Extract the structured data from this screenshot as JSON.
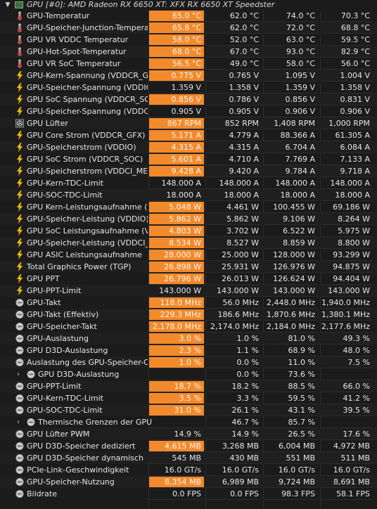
{
  "header": {
    "title": "GPU [#0]: AMD Radeon RX 6650 XT: XFX RX 6650 XT Speedster"
  },
  "rows": [
    {
      "icon": "thermometer-icon",
      "label": "GPU-Temperatur",
      "current": "65.0 °C",
      "min": "62.0 °C",
      "max": "74.0 °C",
      "avg": "70.3 °C",
      "hi": true
    },
    {
      "icon": "thermometer-icon",
      "label": "GPU-Speicher-Junction-Temperatur",
      "current": "65.8 °C",
      "min": "62.0 °C",
      "max": "72.0 °C",
      "avg": "68.8 °C",
      "hi": true
    },
    {
      "icon": "thermometer-icon",
      "label": "GPU VR VDDC Temperatur",
      "current": "58.0 °C",
      "min": "52.0 °C",
      "max": "63.0 °C",
      "avg": "59.5 °C",
      "hi": true
    },
    {
      "icon": "thermometer-icon",
      "label": "GPU-Hot-Spot-Temperatur",
      "current": "68.0 °C",
      "min": "67.0 °C",
      "max": "93.0 °C",
      "avg": "82.9 °C",
      "hi": true
    },
    {
      "icon": "thermometer-icon",
      "label": "GPU VR SoC Temperatur",
      "current": "56.5 °C",
      "min": "49.0 °C",
      "max": "58.0 °C",
      "avg": "56.0 °C",
      "hi": true
    },
    {
      "icon": "lightning-icon",
      "label": "GPU-Kern-Spannung (VDDCR_GFX)",
      "current": "0.775 V",
      "min": "0.765 V",
      "max": "1.095 V",
      "avg": "1.004 V",
      "hi": true
    },
    {
      "icon": "lightning-icon",
      "label": "GPU-Speicher-Spannung (VDDIO)",
      "current": "1.359 V",
      "min": "1.358 V",
      "max": "1.359 V",
      "avg": "1.358 V",
      "hi": false
    },
    {
      "icon": "lightning-icon",
      "label": "GPU SoC Spannung (VDDCR_SOC)",
      "current": "0.856 V",
      "min": "0.786 V",
      "max": "0.856 V",
      "avg": "0.831 V",
      "hi": true
    },
    {
      "icon": "lightning-icon",
      "label": "GPU-Speicher-Spannung (VDDCI_MEM)",
      "current": "0.905 V",
      "min": "0.905 V",
      "max": "0.906 V",
      "avg": "0.906 V",
      "hi": false
    },
    {
      "icon": "fan-icon",
      "label": "GPU Lüfter",
      "current": "867 RPM",
      "min": "852 RPM",
      "max": "1,408 RPM",
      "avg": "1,000 RPM",
      "hi": true
    },
    {
      "icon": "lightning-icon",
      "label": "GPU Core Strom (VDDCR_GFX)",
      "current": "5.171 A",
      "min": "4.779 A",
      "max": "88.366 A",
      "avg": "61.305 A",
      "hi": true
    },
    {
      "icon": "lightning-icon",
      "label": "GPU-Speicherstrom (VDDIO)",
      "current": "4.315 A",
      "min": "4.315 A",
      "max": "6.704 A",
      "avg": "6.084 A",
      "hi": true
    },
    {
      "icon": "lightning-icon",
      "label": "GPU SoC Strom (VDDCR_SOC)",
      "current": "5.601 A",
      "min": "4.710 A",
      "max": "7.769 A",
      "avg": "7.133 A",
      "hi": true
    },
    {
      "icon": "lightning-icon",
      "label": "GPU-Speicherstrom (VDDCI_MEM)",
      "current": "9.428 A",
      "min": "9.420 A",
      "max": "9.784 A",
      "avg": "9.718 A",
      "hi": true
    },
    {
      "icon": "lightning-icon",
      "label": "GPU-Kern-TDC-Limit",
      "current": "148.000 A",
      "min": "148.000 A",
      "max": "148.000 A",
      "avg": "148.000 A",
      "hi": false
    },
    {
      "icon": "lightning-icon",
      "label": "GPU-SOC-TDC-Limit",
      "current": "18.000 A",
      "min": "18.000 A",
      "max": "18.000 A",
      "avg": "18.000 A",
      "hi": false
    },
    {
      "icon": "lightning-icon",
      "label": "GPU Kern-Leistungsaufnahme (VDDCR_GFX)",
      "current": "5.048 W",
      "min": "4.461 W",
      "max": "100.455 W",
      "avg": "69.186 W",
      "hi": true
    },
    {
      "icon": "lightning-icon",
      "label": "GPU-Speicher-Leistung (VDDIO)",
      "current": "5.862 W",
      "min": "5.862 W",
      "max": "9.106 W",
      "avg": "8.264 W",
      "hi": true
    },
    {
      "icon": "lightning-icon",
      "label": "GPU SoC Leistungsaufnahme (VDDCR_SOC)",
      "current": "4.803 W",
      "min": "3.702 W",
      "max": "6.522 W",
      "avg": "5.975 W",
      "hi": true
    },
    {
      "icon": "lightning-icon",
      "label": "GPU-Speicher-Leistung (VDDCI_MEM)",
      "current": "8.534 W",
      "min": "8.527 W",
      "max": "8.859 W",
      "avg": "8.800 W",
      "hi": true
    },
    {
      "icon": "lightning-icon",
      "label": "GPU ASIC Leistungsaufnahme",
      "current": "28.000 W",
      "min": "25.000 W",
      "max": "128.000 W",
      "avg": "93.299 W",
      "hi": true
    },
    {
      "icon": "lightning-icon",
      "label": "Total Graphics Power (TGP)",
      "current": "26.898 W",
      "min": "25.931 W",
      "max": "126.976 W",
      "avg": "94.875 W",
      "hi": true
    },
    {
      "icon": "lightning-icon",
      "label": "GPU PPT",
      "current": "26.796 W",
      "min": "26.013 W",
      "max": "126.624 W",
      "avg": "94.404 W",
      "hi": true
    },
    {
      "icon": "lightning-icon",
      "label": "GPU-PPT-Limit",
      "current": "143.000 W",
      "min": "143.000 W",
      "max": "143.000 W",
      "avg": "143.000 W",
      "hi": false
    },
    {
      "icon": "gauge-icon",
      "label": "GPU-Takt",
      "current": "118.0 MHz",
      "min": "56.0 MHz",
      "max": "2,448.0 MHz",
      "avg": "1,940.0 MHz",
      "hi": true
    },
    {
      "icon": "gauge-icon",
      "label": "GPU-Takt (Effektiv)",
      "current": "229.3 MHz",
      "min": "186.6 MHz",
      "max": "1,870.6 MHz",
      "avg": "1,380.1 MHz",
      "hi": true
    },
    {
      "icon": "gauge-icon",
      "label": "GPU-Speicher-Takt",
      "current": "2,178.0 MHz",
      "min": "2,174.0 MHz",
      "max": "2,184.0 MHz",
      "avg": "2,177.6 MHz",
      "hi": true
    },
    {
      "icon": "gauge-icon",
      "label": "GPU-Auslastung",
      "current": "3.0 %",
      "min": "1.0 %",
      "max": "81.0 %",
      "avg": "49.3 %",
      "hi": true
    },
    {
      "icon": "gauge-icon",
      "label": "GPU D3D-Auslastung",
      "current": "2.3 %",
      "min": "1.1 %",
      "max": "68.9 %",
      "avg": "48.0 %",
      "hi": true
    },
    {
      "icon": "gauge-icon",
      "label": "Auslastung des GPU-Speicher-Controllers",
      "current": "1.0 %",
      "min": "0.0 %",
      "max": "11.0 %",
      "avg": "7.5 %",
      "hi": true
    },
    {
      "icon": "gauge-icon",
      "label": "GPU D3D-Auslastung",
      "current": "",
      "min": "0.0 %",
      "max": "73.6 %",
      "avg": "",
      "hi": false,
      "group": true
    },
    {
      "icon": "gauge-icon",
      "label": "GPU-PPT-Limit",
      "current": "18.7 %",
      "min": "18.2 %",
      "max": "88.5 %",
      "avg": "66.0 %",
      "hi": true
    },
    {
      "icon": "gauge-icon",
      "label": "GPU-Kern-TDC-Limit",
      "current": "3.5 %",
      "min": "3.3 %",
      "max": "59.5 %",
      "avg": "41.2 %",
      "hi": true
    },
    {
      "icon": "gauge-icon",
      "label": "GPU-SOC-TDC-Limit",
      "current": "31.0 %",
      "min": "26.1 %",
      "max": "43.1 %",
      "avg": "39.5 %",
      "hi": true
    },
    {
      "icon": "gauge-icon",
      "label": "Thermische Grenzen der GPU",
      "current": "",
      "min": "46.7 %",
      "max": "85.7 %",
      "avg": "",
      "hi": false,
      "group": true
    },
    {
      "icon": "gauge-icon",
      "label": "GPU Lüfter PWM",
      "current": "14.9 %",
      "min": "14.9 %",
      "max": "26.5 %",
      "avg": "17.6 %",
      "hi": false
    },
    {
      "icon": "gauge-icon",
      "label": "GPU D3D-Speicher dediziert",
      "current": "4,615 MB",
      "min": "3,268 MB",
      "max": "6,004 MB",
      "avg": "4,972 MB",
      "hi": true
    },
    {
      "icon": "gauge-icon",
      "label": "GPU D3D-Speicher dynamisch",
      "current": "545 MB",
      "min": "430 MB",
      "max": "551 MB",
      "avg": "511 MB",
      "hi": false
    },
    {
      "icon": "gauge-icon",
      "label": "PCIe-Link-Geschwindigkeit",
      "current": "16.0 GT/s",
      "min": "16.0 GT/s",
      "max": "16.0 GT/s",
      "avg": "16.0 GT/s",
      "hi": false
    },
    {
      "icon": "gauge-icon",
      "label": "GPU-Speicher-Nutzung",
      "current": "8,354 MB",
      "min": "6,989 MB",
      "max": "9,724 MB",
      "avg": "8,691 MB",
      "hi": true
    },
    {
      "icon": "gauge-icon",
      "label": "Bildrate",
      "current": "0.0 FPS",
      "min": "0.0 FPS",
      "max": "98.3 FPS",
      "avg": "58.1 FPS",
      "hi": false
    }
  ],
  "colors": {
    "highlight": "#f28a2c",
    "background": "#1b1b1b",
    "text": "#e6e6e6"
  }
}
